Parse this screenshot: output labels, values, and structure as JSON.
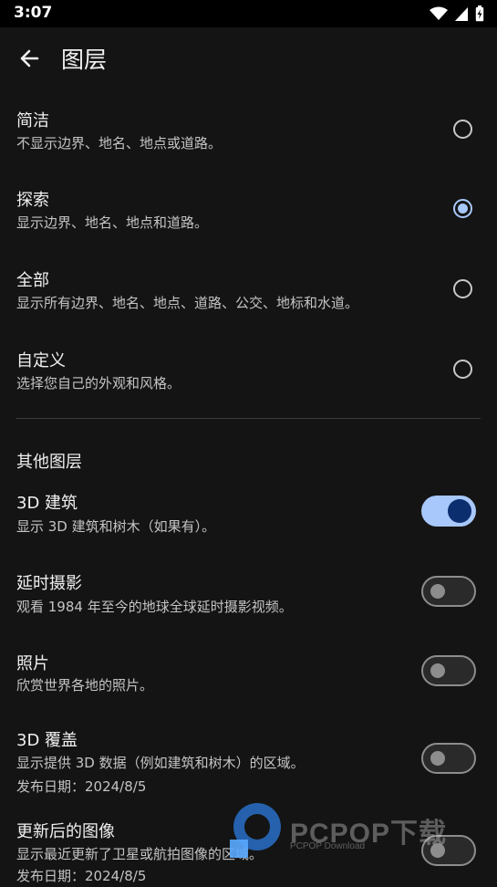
{
  "status_bar": {
    "time": "3:07"
  },
  "header": {
    "title": "图层"
  },
  "map_types": [
    {
      "title": "简洁",
      "description": "不显示边界、地名、地点或道路。",
      "selected": false
    },
    {
      "title": "探索",
      "description": "显示边界、地名、地点和道路。",
      "selected": true
    },
    {
      "title": "全部",
      "description": "显示所有边界、地名、地点、道路、公交、地标和水道。",
      "selected": false
    },
    {
      "title": "自定义",
      "description": "选择您自己的外观和风格。",
      "selected": false
    }
  ],
  "other_layers": {
    "header": "其他图层",
    "items": [
      {
        "title": "3D 建筑",
        "description": "显示 3D 建筑和树木（如果有）。",
        "enabled": true
      },
      {
        "title": "延时摄影",
        "description": "观看 1984 年至今的地球全球延时摄影视频。",
        "enabled": false
      },
      {
        "title": "照片",
        "description": "欣赏世界各地的照片。",
        "enabled": false
      },
      {
        "title": "3D 覆盖",
        "description": "显示提供 3D 数据（例如建筑和树木）的区域。",
        "date": "发布日期：2024/8/5",
        "enabled": false
      },
      {
        "title": "更新后的图像",
        "description": "显示最近更新了卫星或航拍图像的区域。",
        "date": "发布日期：2024/8/5",
        "enabled": false
      }
    ]
  },
  "watermark": {
    "text": "PCPOP下载",
    "sub": "PCPOP Download"
  },
  "colors": {
    "accent": "#a8c7fa",
    "background": "#141414",
    "switch_on_thumb": "#0b2e6e"
  }
}
